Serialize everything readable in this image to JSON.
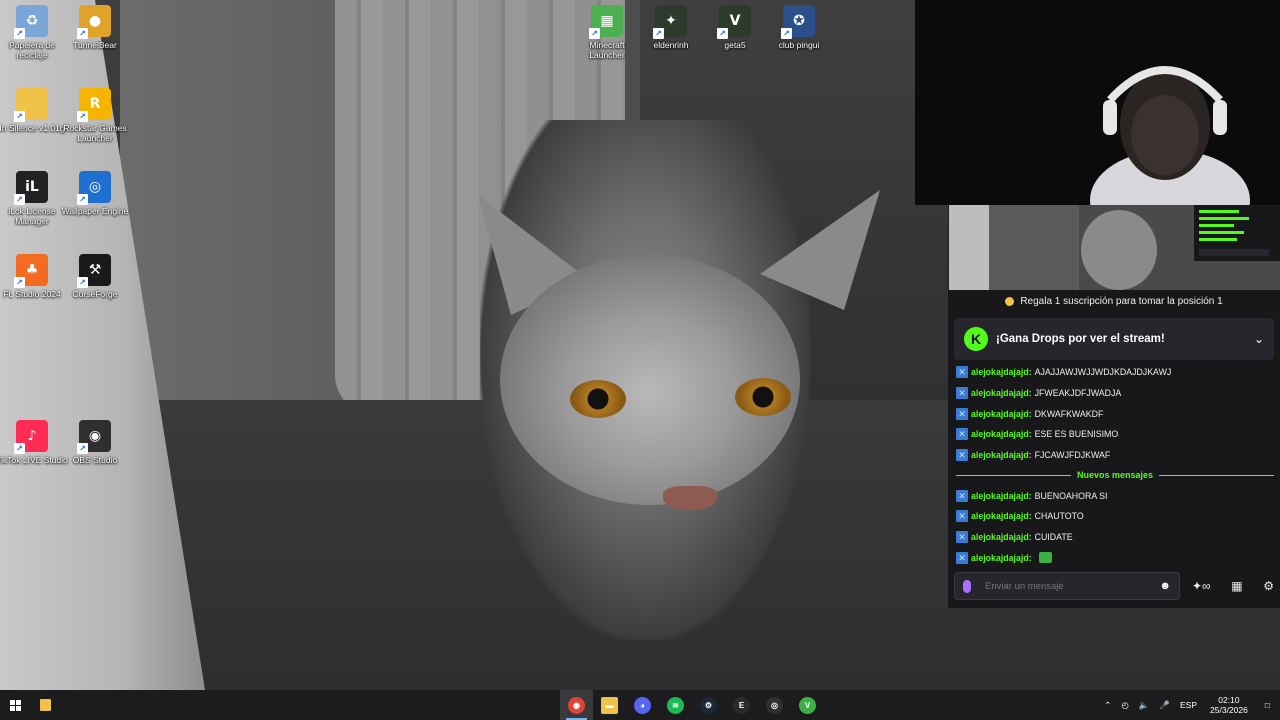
{
  "desktop": {
    "icons": [
      {
        "label": "Papelera de reciclaje",
        "icon": "recycle-bin-icon",
        "color": "#7aa6d8"
      },
      {
        "label": "TunnelBear",
        "icon": "bear-icon",
        "color": "#e0a32a"
      },
      {
        "label": "In Silence v1.01g",
        "icon": "folder-icon",
        "color": "#f0c24a"
      },
      {
        "label": "Rockstar Games Launcher",
        "icon": "rockstar-icon",
        "color": "#f4b400"
      },
      {
        "label": "iLok License Manager",
        "icon": "ilok-icon",
        "color": "#222222"
      },
      {
        "label": "Wallpaper Engine",
        "icon": "wallpaper-engine-icon",
        "color": "#1f6fd1"
      },
      {
        "label": "FL Studio 2024",
        "icon": "fl-studio-icon",
        "color": "#f26b21"
      },
      {
        "label": "CurseForge",
        "icon": "curseforge-icon",
        "color": "#1a1a1a"
      },
      {
        "label": "TikTok LIVE Studio",
        "icon": "tiktok-icon",
        "color": "#fe2c55"
      },
      {
        "label": "OBS Studio",
        "icon": "obs-icon",
        "color": "#302e31"
      },
      {
        "label": "Minecraft Launcher",
        "icon": "minecraft-icon",
        "color": "#4caf50"
      },
      {
        "label": "eldenrinh",
        "icon": "elden-ring-icon",
        "color": "#2f3a2f"
      },
      {
        "label": "geta5",
        "icon": "gta5-icon",
        "color": "#2d3b2b"
      },
      {
        "label": "club pingui",
        "icon": "counter-strike-icon",
        "color": "#2a4f8a"
      }
    ]
  },
  "chat": {
    "gift_banner": "Regala 1 suscripción para tomar la posición 1",
    "drops_banner": "¡Gana Drops por ver el stream!",
    "messages_before": [
      {
        "user": "alejokajdajajd:",
        "text": "AJAJJAWJWJJWDJKDAJDJKAWJ"
      },
      {
        "user": "alejokajdajajd:",
        "text": "JFWEAKJDFJWADJA"
      },
      {
        "user": "alejokajdajajd:",
        "text": "DKWAFKWAKDF"
      },
      {
        "user": "alejokajdajajd:",
        "text": "ESE ES BUENISIMO"
      },
      {
        "user": "alejokajdajajd:",
        "text": "FJCAWJFDJKWAF"
      }
    ],
    "new_messages_label": "Nuevos mensajes",
    "messages_after": [
      {
        "user": "alejokajdajajd:",
        "text": "BUENOAHORA SI"
      },
      {
        "user": "alejokajdajajd:",
        "text": "CHAUTOTO"
      },
      {
        "user": "alejokajdajajd:",
        "text": "CUIDATE"
      },
      {
        "user": "alejokajdajajd:",
        "text": ""
      }
    ],
    "input_placeholder": "Enviar un mensaje",
    "accent_color": "#53fc18"
  },
  "taskbar": {
    "apps": [
      "chrome-icon",
      "file-explorer-icon",
      "discord-icon",
      "spotify-icon",
      "steam-icon",
      "epic-games-icon",
      "obs-icon",
      "vector-icon"
    ],
    "language": "ESP",
    "time": "02:10",
    "date": "25/3/2026"
  }
}
